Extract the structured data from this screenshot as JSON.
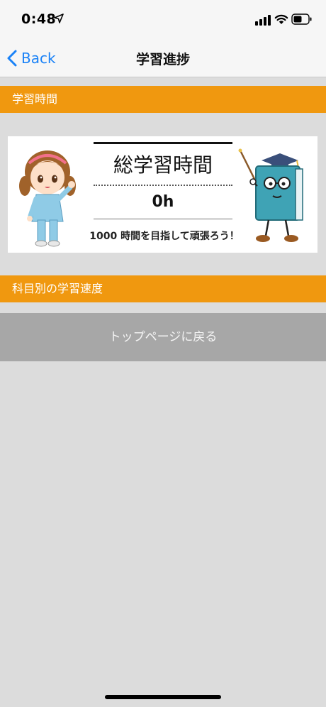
{
  "status_bar": {
    "time": "0:48"
  },
  "nav": {
    "back_label": "Back",
    "title": "学習進捗"
  },
  "sections": {
    "study_time_header": "学習時間",
    "subject_speed_header": "科目別の学習速度"
  },
  "banner": {
    "title": "総学習時間",
    "value": "0h",
    "goal_text": "1000 時間を目指して頑張ろう！"
  },
  "buttons": {
    "top_page_label": "トップページに戻る"
  },
  "colors": {
    "accent": "#f0980f",
    "link_blue": "#1a82f7",
    "button_gray": "#a7a7a7",
    "background": "#dcdcdc"
  }
}
